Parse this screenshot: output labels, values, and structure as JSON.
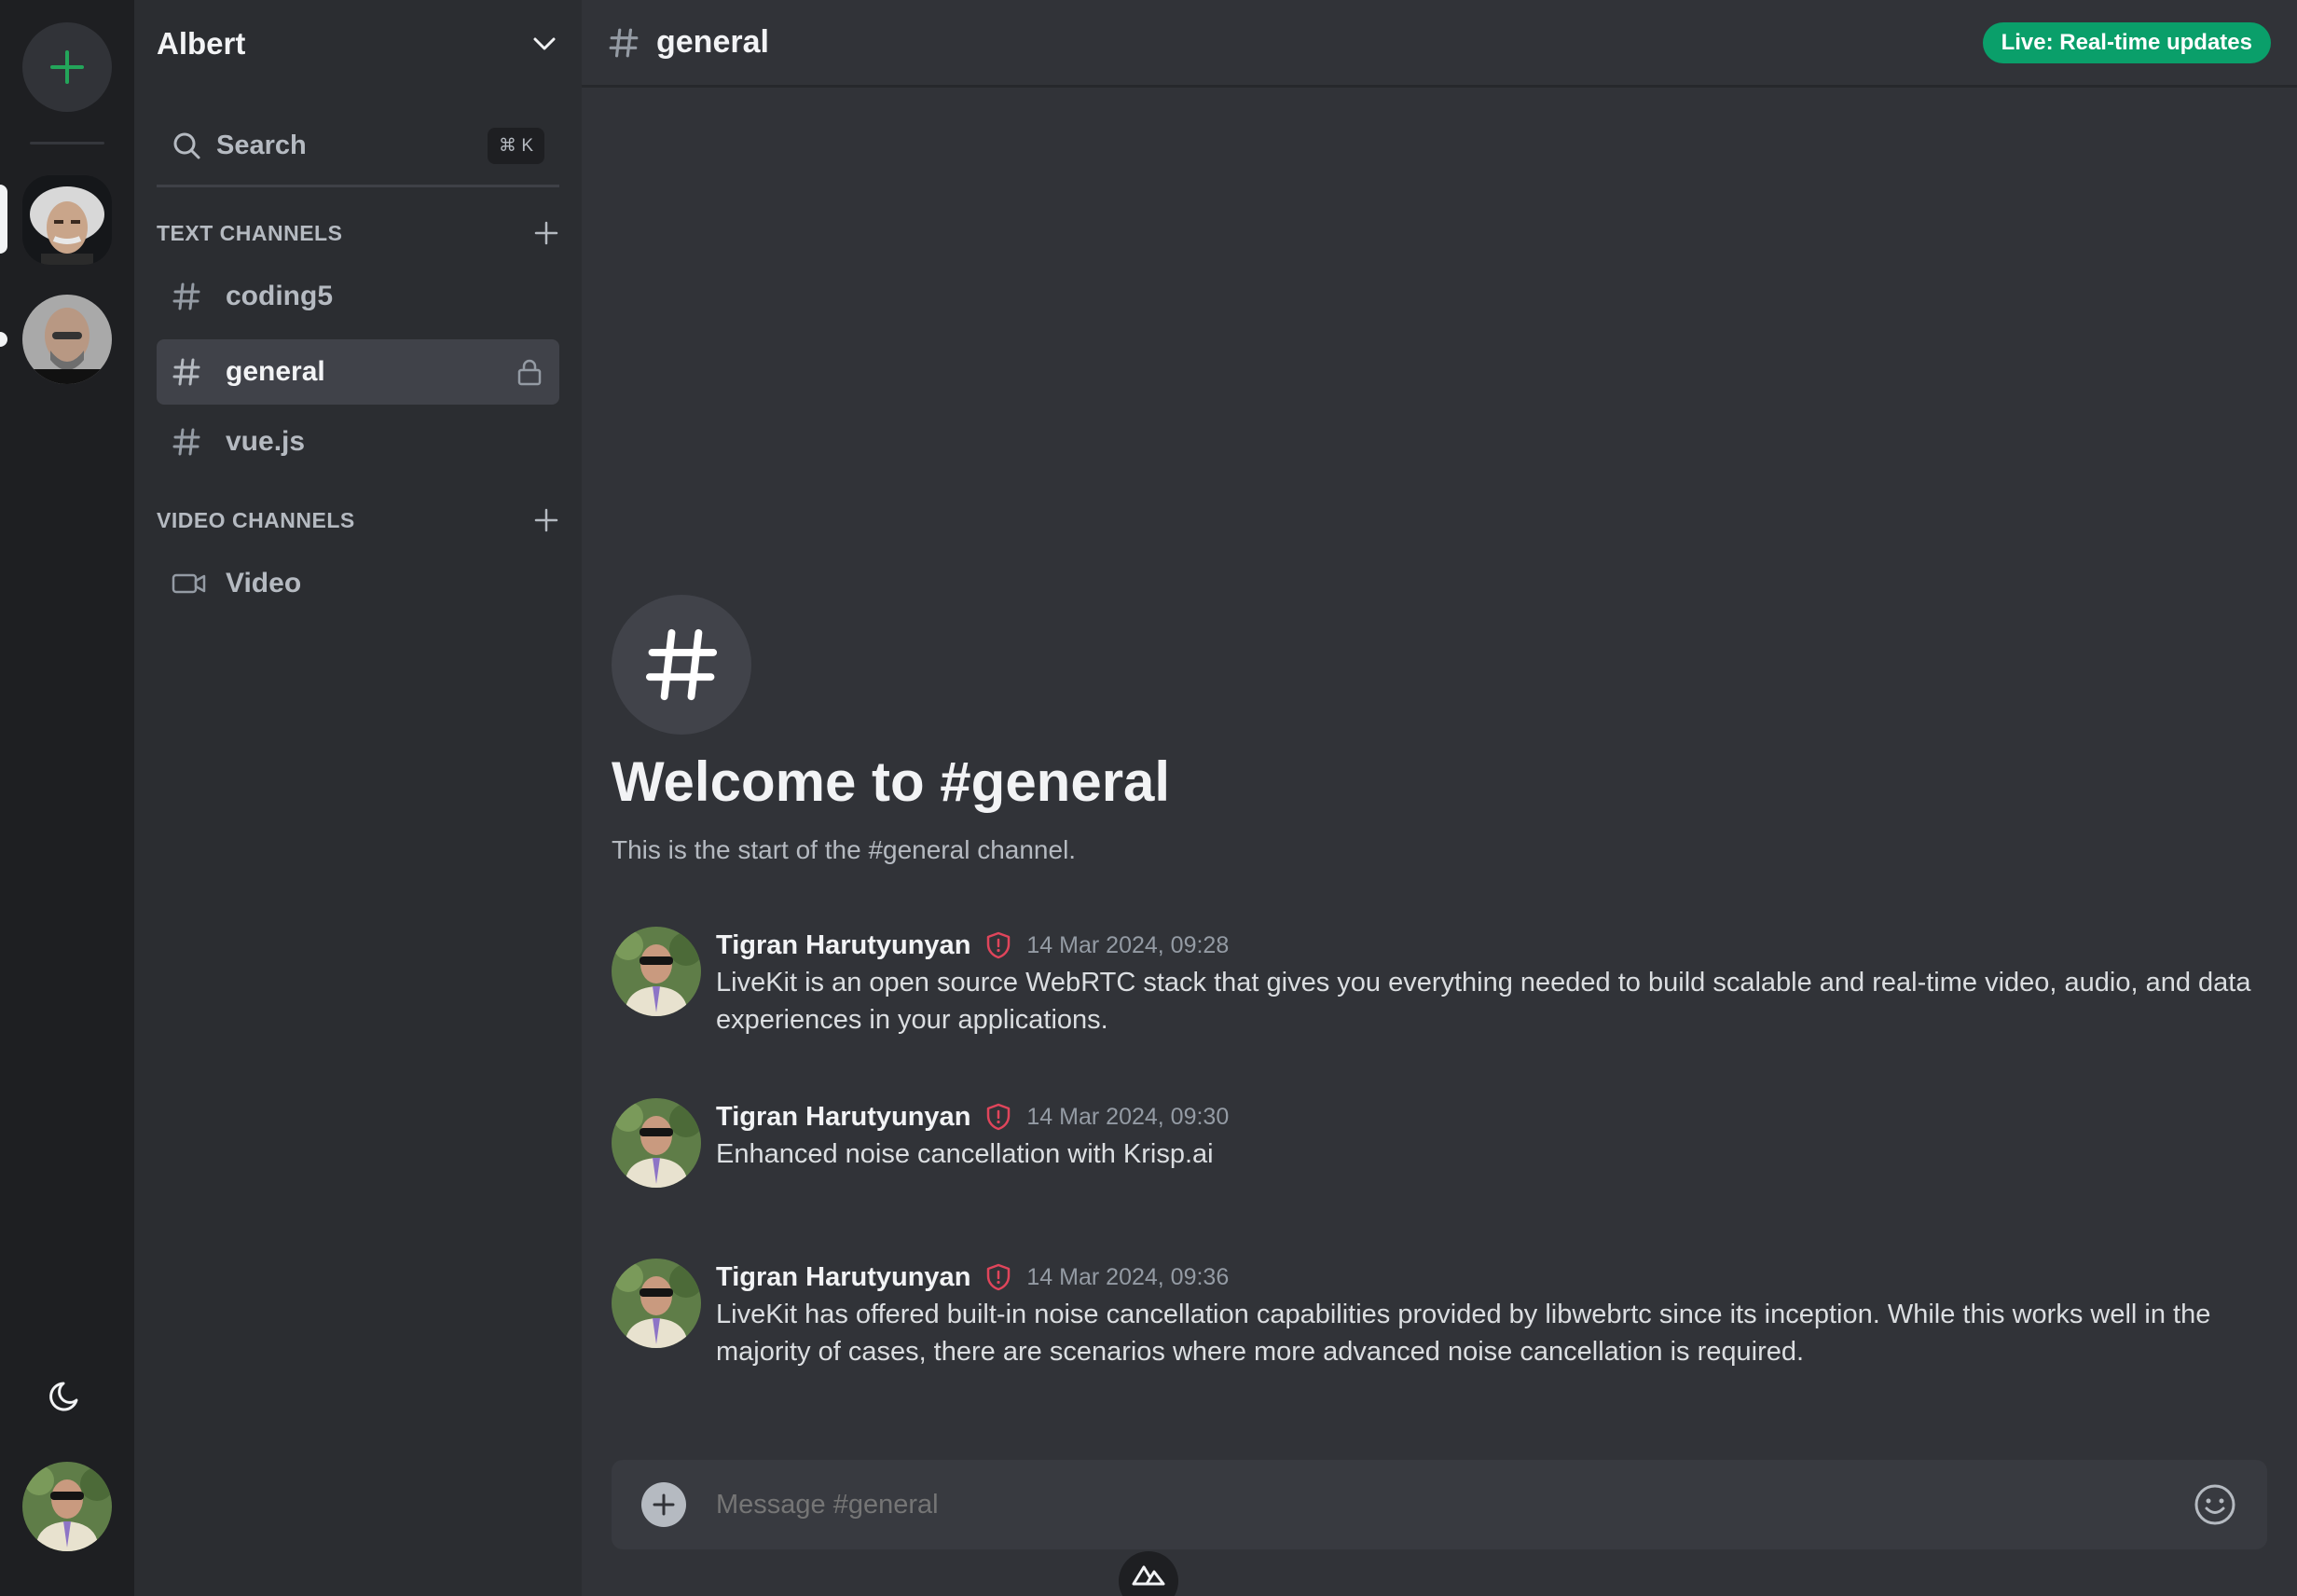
{
  "server": {
    "name": "Albert",
    "search_label": "Search",
    "search_shortcut": "⌘ K"
  },
  "sections": {
    "text_title": "TEXT CHANNELS",
    "video_title": "VIDEO CHANNELS"
  },
  "channels": {
    "text": [
      {
        "label": "coding5"
      },
      {
        "label": "general"
      },
      {
        "label": "vue.js"
      }
    ],
    "video": [
      {
        "label": "Video"
      }
    ]
  },
  "header": {
    "channel": "general",
    "live_badge": "Live: Real-time updates"
  },
  "welcome": {
    "title": "Welcome to #general",
    "subtitle": "This is the start of the #general channel."
  },
  "messages": [
    {
      "author": "Tigran Harutyunyan",
      "time": "14 Mar 2024, 09:28",
      "text": "LiveKit is an open source WebRTC stack that gives you everything needed to build scalable and real-time video, audio, and data experiences in your applications."
    },
    {
      "author": "Tigran Harutyunyan",
      "time": "14 Mar 2024, 09:30",
      "text": "Enhanced noise cancellation with Krisp.ai"
    },
    {
      "author": "Tigran Harutyunyan",
      "time": "14 Mar 2024, 09:36",
      "text": "LiveKit has offered built-in noise cancellation capabilities provided by libwebrtc since its inception. While this works well in the majority of cases, there are scenarios where more advanced noise cancellation is required."
    }
  ],
  "composer": {
    "placeholder": "Message #general"
  },
  "colors": {
    "accent_green": "#23a55a",
    "live_badge": "#0a9f6a",
    "moderator_badge": "#e0455b"
  },
  "icons": {
    "rail_add": "plus-icon",
    "theme": "moon-icon",
    "channel": "hash-icon",
    "locked": "lock-icon",
    "video": "video-camera-icon",
    "moderator": "shield-alert-icon",
    "emoji": "smiley-icon"
  }
}
